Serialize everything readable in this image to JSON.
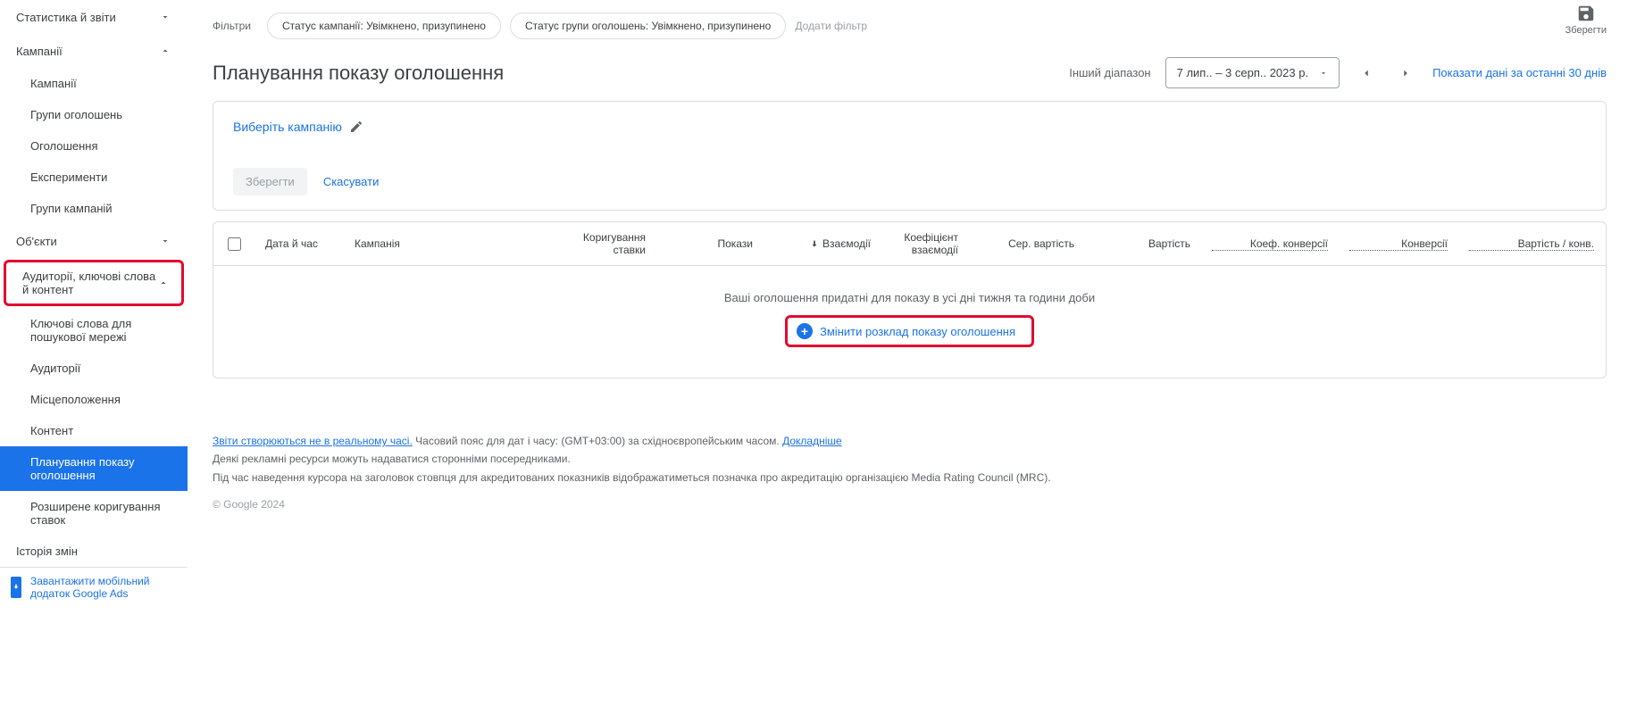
{
  "sidebar": {
    "stats": "Статистика й звіти",
    "campaigns": "Кампанії",
    "sub_campaigns": "Кампанії",
    "sub_adgroups": "Групи оголошень",
    "sub_ads": "Оголошення",
    "sub_experiments": "Експерименти",
    "sub_campaign_groups": "Групи кампаній",
    "objects": "Об'єкти",
    "audiences_kw": "Аудиторії, ключові слова й контент",
    "sub_search_kw": "Ключові слова для пошукової мережі",
    "sub_audiences": "Аудиторії",
    "sub_locations": "Місцеположення",
    "sub_content": "Контент",
    "sub_schedule": "Планування показу оголошення",
    "sub_bid_adj": "Розширене коригування ставок",
    "history": "Історія змін",
    "download": "Завантажити мобільний додаток Google Ads"
  },
  "filters": {
    "label": "Фільтри",
    "chip1": "Статус кампанії: Увімкнено, призупинено",
    "chip2": "Статус групи оголошень: Увімкнено, призупинено",
    "add": "Додати фільтр",
    "save": "Зберегти"
  },
  "page": {
    "title": "Планування показу оголошення",
    "range_label": "Інший діапазон",
    "date_range": "7 лип.. – 3 серп.. 2023 р.",
    "last30": "Показати дані за останні 30 днів"
  },
  "panel": {
    "select_campaign": "Виберіть кампанію",
    "save": "Зберегти",
    "cancel": "Скасувати"
  },
  "grid": {
    "col_date": "Дата й час",
    "col_campaign": "Кампанія",
    "col_adj": "Коригування ставки",
    "col_imp": "Покази",
    "col_inter": "Взаємодії",
    "col_coef": "Коефіцієнт взаємодії",
    "col_avgcost": "Сер. вартість",
    "col_cost": "Вартість",
    "col_convrate": "Коеф. конверсії",
    "col_conv": "Конверсії",
    "col_costconv": "Вартість / конв.",
    "empty": "Ваші оголошення придатні для показу в усі дні тижня та години доби",
    "change": "Змінити розклад показу оголошення"
  },
  "footer": {
    "realtime": "Звіти створюються не в реальному часі.",
    "tz": " Часовий пояс для дат і часу: (GMT+03:00) за східноєвропейським часом. ",
    "more": "Докладніше",
    "line2": "Деякі рекламні ресурси можуть надаватися сторонніми посередниками.",
    "line3": "Під час наведення курсора на заголовок стовпця для акредитованих показників відображатиметься позначка про акредитацію організацією Media Rating Council (MRC).",
    "copyright": "© Google 2024"
  }
}
